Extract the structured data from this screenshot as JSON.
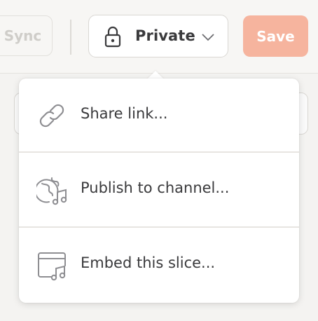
{
  "toolbar": {
    "sync_label": "Sync",
    "privacy_label": "Private",
    "save_label": "Save"
  },
  "menu": {
    "items": [
      {
        "label": "Share link...",
        "icon": "link-icon"
      },
      {
        "label": "Publish to channel...",
        "icon": "globe-music-icon"
      },
      {
        "label": "Embed this slice...",
        "icon": "window-music-icon"
      }
    ]
  },
  "colors": {
    "save_button": "#f6b49e",
    "text": "#3a3a3c",
    "icon": "#8e8e92"
  }
}
